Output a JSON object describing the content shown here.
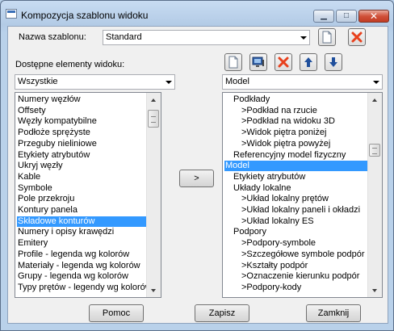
{
  "window": {
    "title": "Kompozycja szablonu widoku"
  },
  "template": {
    "label": "Nazwa szablonu:",
    "value": "Standard"
  },
  "available": {
    "label": "Dostępne elementy widoku:",
    "filter": "Wszystkie",
    "items": [
      "Numery węzłów",
      "Offsety",
      "Węzły kompatybilne",
      "Podłoże sprężyste",
      "Przeguby nieliniowe",
      "Etykiety atrybutów",
      "Ukryj węzły",
      "Kable",
      "Symbole",
      "Pole przekroju",
      "Kontury panela",
      "Składowe konturów",
      "Numery i opisy krawędzi",
      "Emitery",
      "Profile - legenda wg kolorów",
      "Materiały - legenda wg kolorów",
      "Grupy - legenda wg kolorów",
      "Typy prętów - legendy wg kolorów"
    ],
    "selected_index": 11
  },
  "transfer_label": ">",
  "view": {
    "filter": "Model",
    "items": [
      "Podkłady",
      ">Podkład na rzucie",
      ">Podkład na widoku 3D",
      ">Widok piętra poniżej",
      ">Widok piętra powyżej",
      "Referencyjny model fizyczny",
      "Model",
      "Etykiety atrybutów",
      "Układy lokalne",
      ">Układ lokalny prętów",
      ">Układ lokalny paneli i okładzi",
      ">Układ lokalny ES",
      "Podpory",
      ">Podpory-symbole",
      ">Szczegółowe symbole podpór",
      ">Kształty podpór",
      ">Oznaczenie kierunku podpór",
      ">Podpory-kody"
    ],
    "indent": [
      1,
      2,
      2,
      2,
      2,
      1,
      0,
      1,
      1,
      2,
      2,
      2,
      1,
      2,
      2,
      2,
      2,
      2
    ],
    "selected_index": 6
  },
  "buttons": {
    "help": "Pomoc",
    "save": "Zapisz",
    "close": "Zamknij"
  },
  "colors": {
    "selection": "#3399ff",
    "delete": "#e8401c",
    "arrow": "#1f4f9c"
  }
}
